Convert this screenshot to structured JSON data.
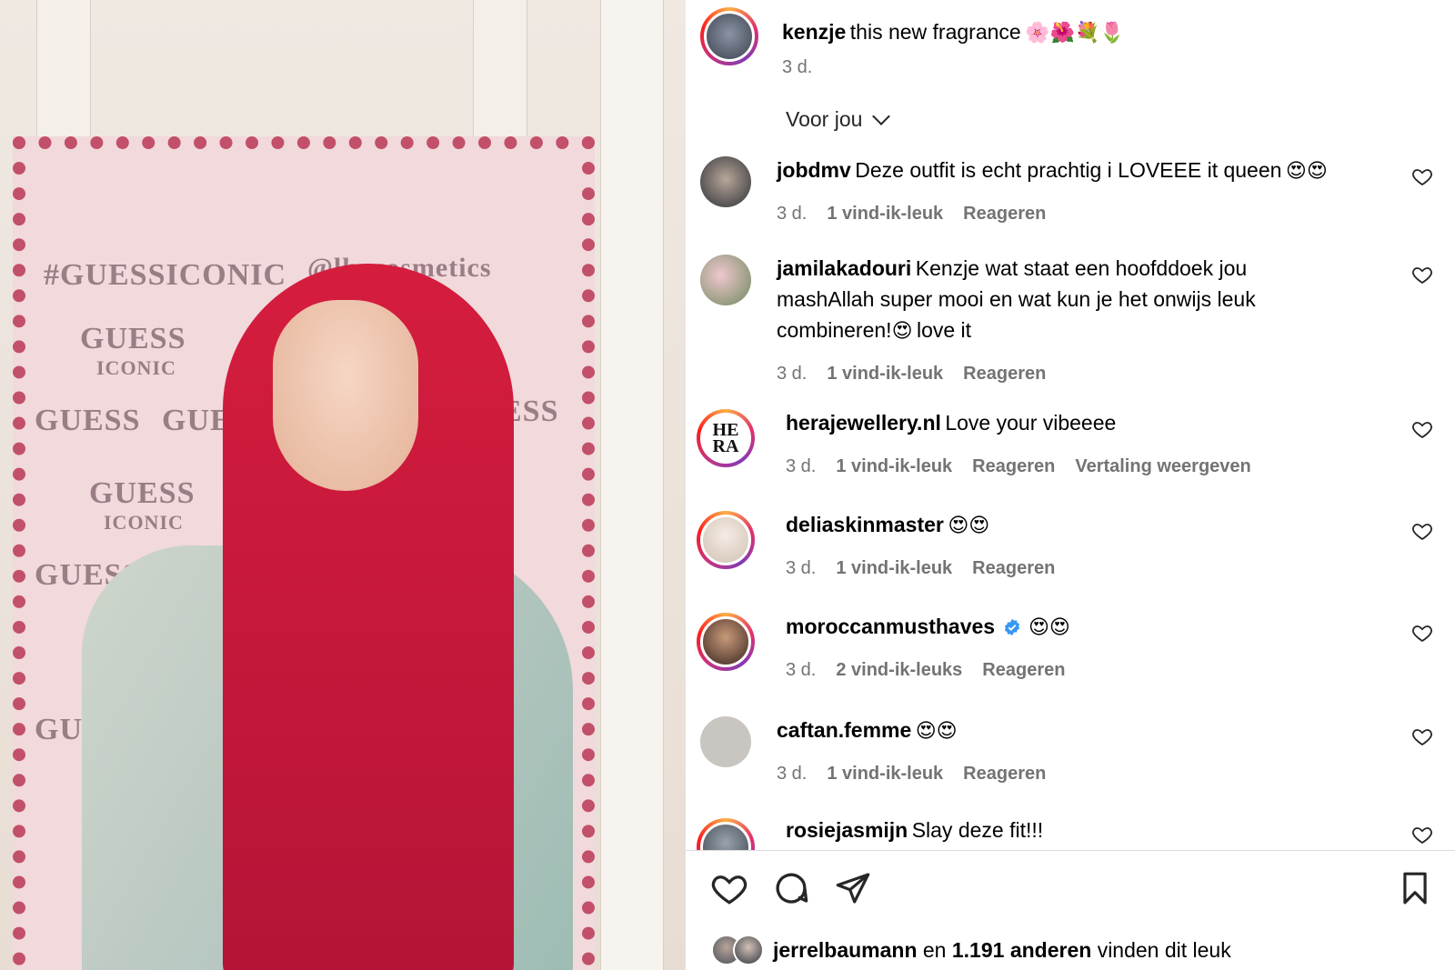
{
  "caption": {
    "username": "kenzje",
    "text": "this new fragrance",
    "emojis": "🌸🌺💐🌷",
    "time": "3 d."
  },
  "filter": {
    "label": "Voor jou"
  },
  "comments": [
    {
      "username": "jobdmv",
      "text": "Deze outfit is echt prachtig i LOVEEE it queen",
      "emojis": "😍😍",
      "time": "3 d.",
      "likes": "1 vind-ik-leuk",
      "reply": "Reageren",
      "translate": ""
    },
    {
      "username": "jamilakadouri",
      "text": "Kenzje wat staat een hoofddoek jou mashAllah super mooi en wat kun je het onwijs leuk combineren!",
      "emojis": "😍",
      "text_after": "love it",
      "time": "3 d.",
      "likes": "1 vind-ik-leuk",
      "reply": "Reageren",
      "translate": ""
    },
    {
      "username": "herajewellery.nl",
      "text": "Love your vibeeee",
      "emojis": "",
      "time": "3 d.",
      "likes": "1 vind-ik-leuk",
      "reply": "Reageren",
      "translate": "Vertaling weergeven",
      "avatar_text": "HE RA"
    },
    {
      "username": "deliaskinmaster",
      "text": "",
      "emojis": "😍😍",
      "time": "3 d.",
      "likes": "1 vind-ik-leuk",
      "reply": "Reageren",
      "translate": ""
    },
    {
      "username": "moroccanmusthaves",
      "text": "",
      "emojis": "😍😍",
      "time": "3 d.",
      "likes": "2 vind-ik-leuks",
      "reply": "Reageren",
      "translate": "",
      "verified": true
    },
    {
      "username": "caftan.femme",
      "text": "",
      "emojis": "😍😍",
      "time": "3 d.",
      "likes": "1 vind-ik-leuk",
      "reply": "Reageren",
      "translate": ""
    },
    {
      "username": "rosiejasmijn",
      "text": "Slay deze fit!!!",
      "emojis": "",
      "time": "",
      "likes": "",
      "reply": "",
      "translate": ""
    }
  ],
  "likes_summary": {
    "user": "jerrelbaumann",
    "joiner": "en",
    "others": "1.191 anderen",
    "suffix": "vinden dit leuk"
  },
  "photo": {
    "backdrop_lines": [
      "#GUESSICONIC",
      "@lhacosmetics",
      "GUESS",
      "ICONIC"
    ]
  },
  "icons": {
    "like": "heart-icon",
    "comment": "comment-icon",
    "share": "send-icon",
    "save": "bookmark-icon",
    "comment_like": "heart-icon",
    "verified": "verified-badge-icon",
    "chevron": "chevron-down-icon"
  },
  "colors": {
    "meta": "#737373",
    "verified": "#3897f0",
    "divider": "#dbdbdb"
  }
}
